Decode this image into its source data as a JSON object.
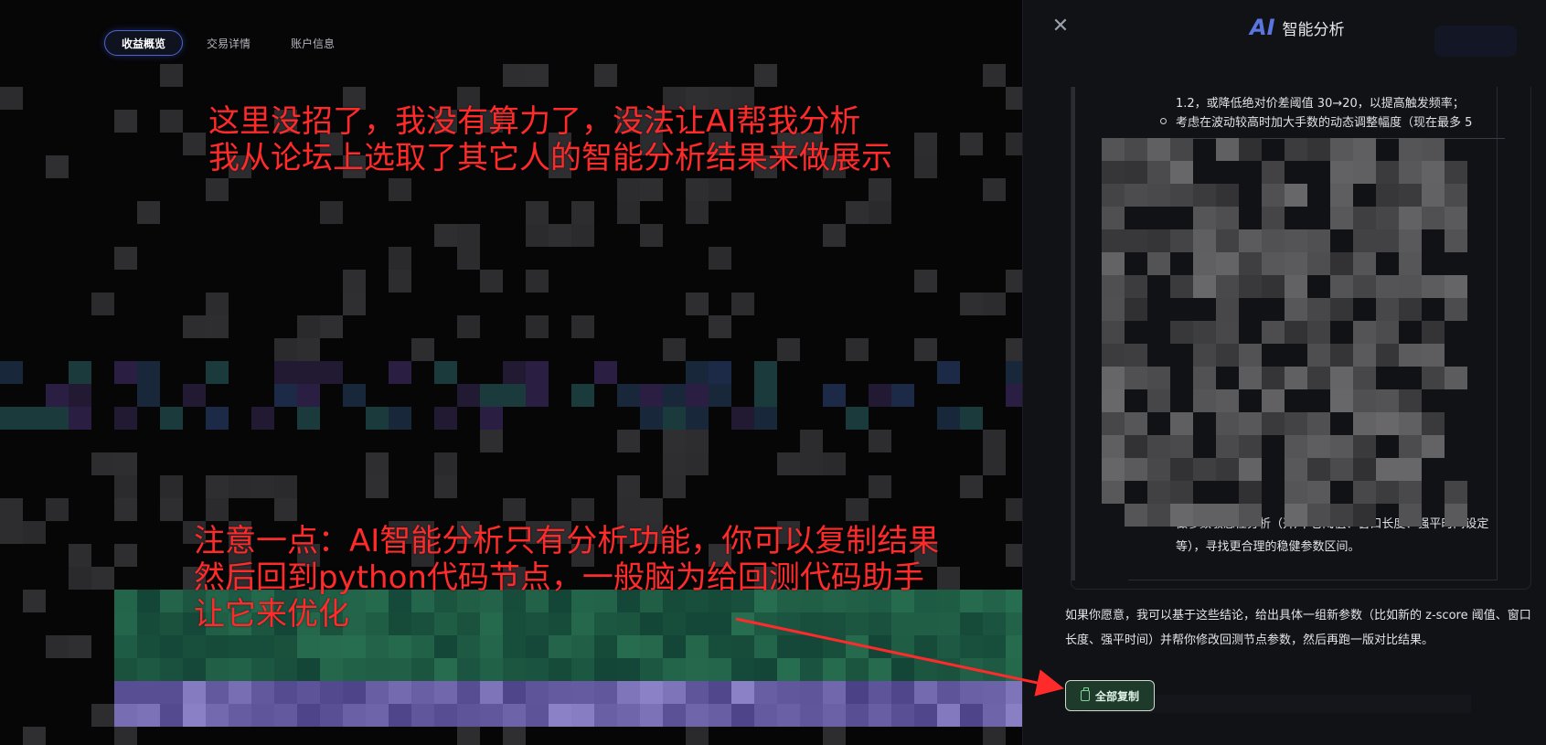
{
  "tabs": [
    {
      "label": "收益概览",
      "active": true
    },
    {
      "label": "交易详情",
      "active": false
    },
    {
      "label": "账户信息",
      "active": false
    }
  ],
  "annotations": {
    "top": "这里没招了，我没有算力了，没法让AI帮我分析\n我从论坛上选取了其它人的智能分析结果来做展示",
    "bottom": "注意一点：AI智能分析只有分析功能，你可以复制结果\n然后回到python代码节点，一般脑为给回测代码助手\n让它来优化",
    "color": "#ff2a2a"
  },
  "panel": {
    "close_icon": "close-icon",
    "logo": "AI",
    "title": "智能分析",
    "content": {
      "line1": "1.2，或降低绝对价差阈值 30→20，以提高触发频率；",
      "bullet1": "考虑在波动较高时加大手数的动态调整幅度（现在最多 5",
      "bullet_last_line1": "做参数敏感性分析（开/平仓阈值、窗口长度、强平时间设定",
      "bullet_last_line2": "等），寻找更合理的稳健参数区间。"
    },
    "followup": "如果你愿意，我可以基于这些结论，给出具体一组新参数（比如新的 z-score 阈值、窗口长度、强平时间）并帮你修改回测节点参数，然后再跑一版对比结果。",
    "copy_button": "全部复制",
    "copy_icon": "clipboard-icon"
  },
  "colors": {
    "accent": "#4b63d8",
    "copy_button_bg": "#1d3a2a",
    "copy_icon": "#7fd49b"
  }
}
